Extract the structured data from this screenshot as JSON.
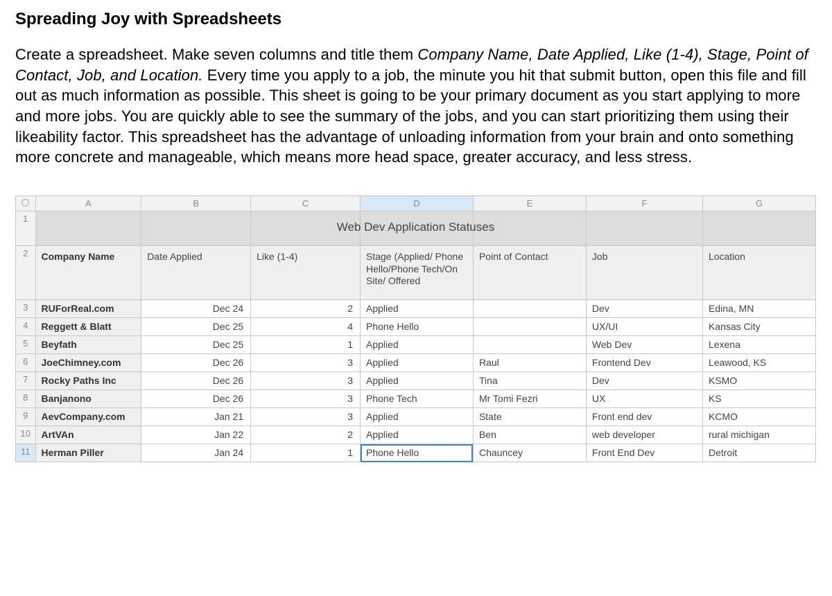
{
  "heading": "Spreading Joy with Spreadsheets",
  "paragraph": {
    "p1": "Create a spreadsheet. Make seven columns and title them ",
    "italics": "Company Name, Date Applied, Like (1-4), Stage, Point of Contact, Job, and Location.",
    "p2": " Every time you apply to a job, the minute you hit that submit button, open this file and fill out as much information as possible. This sheet is going to be your primary document as you start applying to more and more jobs. You are quickly able to see the summary of the jobs, and you can start prioritizing them using their likeability factor. This spreadsheet has the advantage of unloading information from your brain and onto something more concrete and manageable, which means more head space, greater accuracy, and less stress."
  },
  "sheet": {
    "title": "Web Dev Application Statuses",
    "cols": [
      "A",
      "B",
      "C",
      "D",
      "E",
      "F",
      "G"
    ],
    "selectedCol": "D",
    "selectedRow": "11",
    "headers": {
      "company": "Company Name",
      "date": "Date Applied",
      "like": "Like (1-4)",
      "stage": "Stage (Applied/ Phone Hello/Phone Tech/On Site/ Offered",
      "contact": "Point of Contact",
      "job": "Job",
      "location": "Location"
    },
    "rows": [
      {
        "n": "3",
        "company": "RUForReal.com",
        "date": "Dec 24",
        "like": "2",
        "stage": "Applied",
        "contact": "",
        "job": "Dev",
        "location": "Edina, MN"
      },
      {
        "n": "4",
        "company": "Reggett & Blatt",
        "date": "Dec 25",
        "like": "4",
        "stage": "Phone Hello",
        "contact": "",
        "job": "UX/UI",
        "location": "Kansas City"
      },
      {
        "n": "5",
        "company": "Beyfath",
        "date": "Dec 25",
        "like": "1",
        "stage": "Applied",
        "contact": "",
        "job": "Web Dev",
        "location": "Lexena"
      },
      {
        "n": "6",
        "company": "JoeChimney.com",
        "date": "Dec 26",
        "like": "3",
        "stage": "Applied",
        "contact": "Raul",
        "job": "Frontend Dev",
        "location": "Leawood, KS"
      },
      {
        "n": "7",
        "company": "Rocky Paths Inc",
        "date": "Dec 26",
        "like": "3",
        "stage": "Applied",
        "contact": "Tina",
        "job": "Dev",
        "location": "KSMO"
      },
      {
        "n": "8",
        "company": "Banjanono",
        "date": "Dec 26",
        "like": "3",
        "stage": "Phone Tech",
        "contact": "Mr Tomi Fezri",
        "job": "UX",
        "location": "KS"
      },
      {
        "n": "9",
        "company": "AevCompany.com",
        "date": "Jan 21",
        "like": "3",
        "stage": "Applied",
        "contact": "State",
        "job": "Front end dev",
        "location": "KCMO"
      },
      {
        "n": "10",
        "company": "ArtVAn",
        "date": "Jan 22",
        "like": "2",
        "stage": "Applied",
        "contact": "Ben",
        "job": "web developer",
        "location": "rural michigan"
      },
      {
        "n": "11",
        "company": "Herman Piller",
        "date": "Jan 24",
        "like": "1",
        "stage": "Phone Hello",
        "contact": "Chauncey",
        "job": "Front End Dev",
        "location": "Detroit"
      }
    ]
  }
}
